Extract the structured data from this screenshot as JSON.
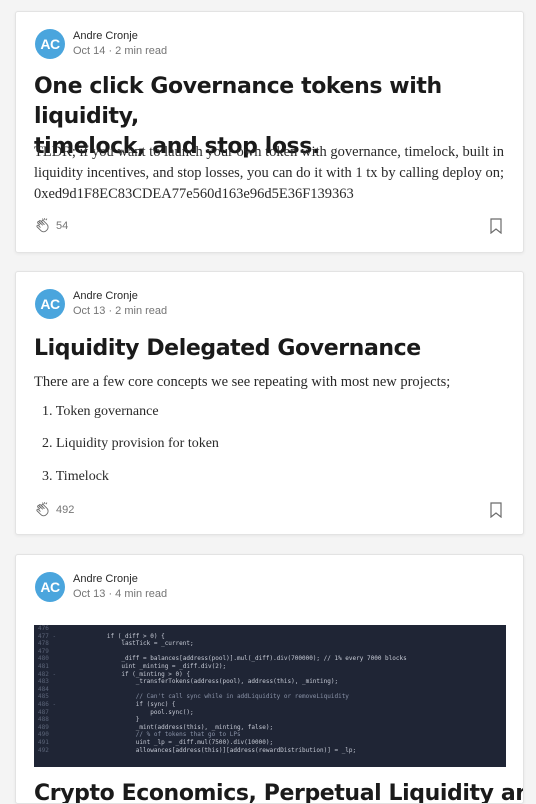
{
  "posts": [
    {
      "avatar": "AC",
      "author": "Andre Cronje",
      "meta": "Oct 14 · 2 min read",
      "title_line1": "One click Governance tokens with liquidity,",
      "title_line2": "timelock, and stop loss.",
      "excerpt_line1": "TLDR; if you want to launch your own token with governance, timelock, built in",
      "excerpt_line2": "liquidity incentives, and stop losses, you can do it with 1 tx by calling deploy on;",
      "excerpt_line3": "0xed9d1F8EC83CDEA77e560d163e96d5E36F139363",
      "claps": "54"
    },
    {
      "avatar": "AC",
      "author": "Andre Cronje",
      "meta": "Oct 13 · 2 min read",
      "title": "Liquidity Delegated Governance",
      "excerpt": "There are a few core concepts we see repeating with most new projects;",
      "list": [
        "1. Token governance",
        "2. Liquidity provision for token",
        "3. Timelock"
      ],
      "claps": "492"
    },
    {
      "avatar": "AC",
      "author": "Andre Cronje",
      "meta": "Oct 13 · 4 min read",
      "code_lines": [
        {
          "n": "476",
          "t": ""
        },
        {
          "n": "477 -",
          "t": "        if (_diff > 0) {"
        },
        {
          "n": "478",
          "t": "            lastTick = _current;"
        },
        {
          "n": "479",
          "t": ""
        },
        {
          "n": "480",
          "t": "            _diff = balances[address(pool)].mul(_diff).div(700000); // 1% every 7000 blocks"
        },
        {
          "n": "481",
          "t": "            uint _minting = _diff.div(2);"
        },
        {
          "n": "482 -",
          "t": "            if (_minting > 0) {"
        },
        {
          "n": "483",
          "t": "                _transferTokens(address(pool), address(this), _minting);"
        },
        {
          "n": "484",
          "t": ""
        },
        {
          "n": "485",
          "t": "                // Can't call sync while in addLiquidity or removeLiquidity"
        },
        {
          "n": "486 -",
          "t": "                if (sync) {"
        },
        {
          "n": "487",
          "t": "                    pool.sync();"
        },
        {
          "n": "488",
          "t": "                }"
        },
        {
          "n": "489",
          "t": "                _mint(address(this), _minting, false);"
        },
        {
          "n": "490",
          "t": "                // % of tokens that go to LPs"
        },
        {
          "n": "491",
          "t": "                uint _lp = _diff.mul(7500).div(10000);"
        },
        {
          "n": "492",
          "t": "                allowances[address(this)][address(rewardDistribution)] = _lp;"
        }
      ],
      "title": "Crypto Economics, Perpetual Liquidity and Il..."
    }
  ]
}
